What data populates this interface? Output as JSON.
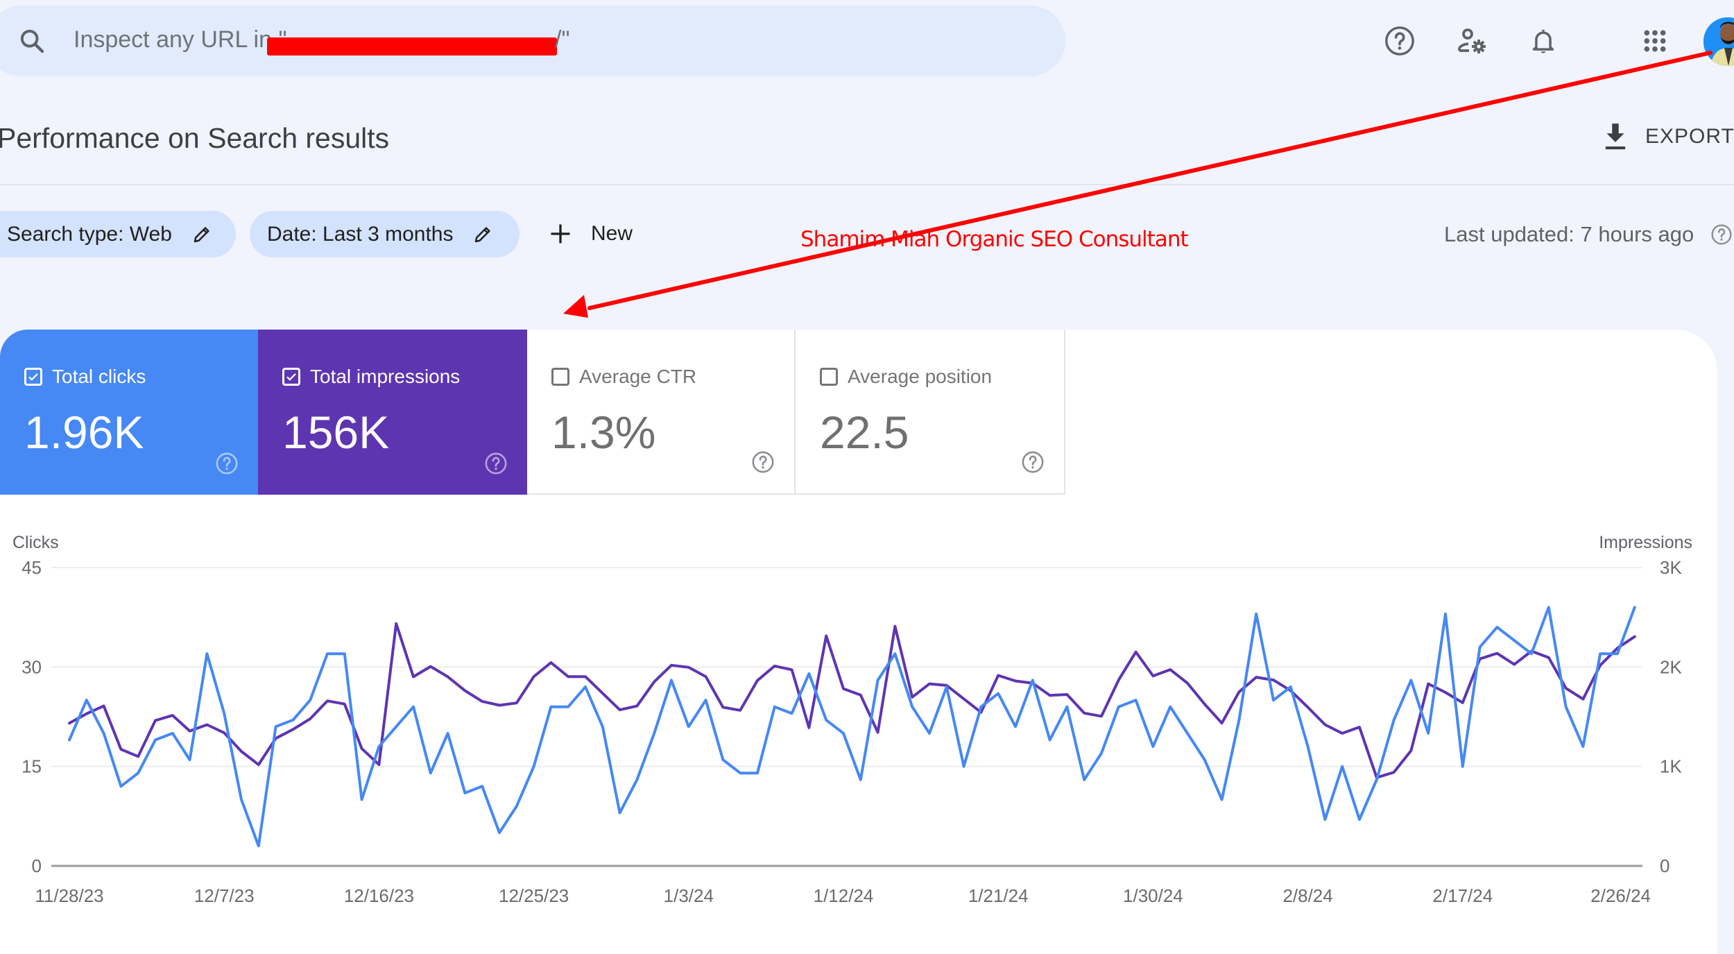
{
  "search": {
    "placeholder_prefix": "Inspect any URL in \"",
    "placeholder_suffix": "/\"",
    "redacted": true
  },
  "top_icons": [
    "help-icon",
    "admin-settings-icon",
    "notifications-bell-icon",
    "apps-grid-icon",
    "account-avatar"
  ],
  "header": {
    "title": "Performance on Search results",
    "export_label": "EXPORT"
  },
  "filters": {
    "search_type": "Search type: Web",
    "date": "Date: Last 3 months",
    "new_label": "New"
  },
  "annotation": {
    "text": "Shamim Miah Organic SEO Consultant",
    "color": "#FF0000"
  },
  "status": {
    "last_updated": "Last updated: 7 hours ago"
  },
  "metrics": [
    {
      "label": "Total clicks",
      "value": "1.96K",
      "checked": true,
      "color": "#4688F4"
    },
    {
      "label": "Total impressions",
      "value": "156K",
      "checked": true,
      "color": "#5E35B1"
    },
    {
      "label": "Average CTR",
      "value": "1.3%",
      "checked": false
    },
    {
      "label": "Average position",
      "value": "22.5",
      "checked": false
    }
  ],
  "chart_data": {
    "type": "line",
    "title": "",
    "xlabel": "",
    "ylabel": "Clicks",
    "y2label": "Impressions",
    "ylim": [
      0,
      45
    ],
    "y2lim": [
      0,
      3000
    ],
    "yticks": [
      "0",
      "15",
      "30",
      "45"
    ],
    "y2ticks": [
      "0",
      "1K",
      "2K",
      "3K"
    ],
    "grid": true,
    "start_date": "11/28/23",
    "end_date": "2/27/24",
    "xtick_labels": [
      "11/28/23",
      "12/7/23",
      "12/16/23",
      "12/25/23",
      "1/3/24",
      "1/12/24",
      "1/21/24",
      "1/30/24",
      "2/8/24",
      "2/17/24",
      "2/26/24"
    ],
    "xtick_every_days": 9,
    "series": [
      {
        "name": "Clicks",
        "axis": "left",
        "color": "#4688F4",
        "values": [
          19,
          25,
          20,
          12,
          14,
          19,
          20,
          16,
          32,
          23,
          10,
          3,
          21,
          22,
          25,
          32,
          32,
          10,
          18,
          21,
          24,
          14,
          20,
          11,
          12,
          5,
          9,
          15,
          24,
          24,
          27,
          21,
          8,
          13,
          20,
          28,
          21,
          25,
          16,
          14,
          14,
          24,
          23,
          29,
          22,
          20,
          13,
          28,
          32,
          24,
          20,
          27,
          15,
          24,
          26,
          21,
          28,
          19,
          24,
          13,
          17,
          24,
          25,
          18,
          24,
          20,
          16,
          10,
          22,
          38,
          25,
          27,
          18,
          7,
          15,
          7,
          13,
          22,
          28,
          20,
          38,
          15,
          33,
          36,
          34,
          32,
          39,
          24,
          18,
          32,
          32,
          39
        ]
      },
      {
        "name": "Impressions",
        "axis": "right",
        "color": "#5E35B1",
        "values": [
          1436,
          1530,
          1608,
          1172,
          1100,
          1462,
          1513,
          1356,
          1420,
          1338,
          1151,
          1018,
          1282,
          1372,
          1479,
          1659,
          1628,
          1180,
          1018,
          2436,
          1902,
          2005,
          1902,
          1762,
          1654,
          1615,
          1638,
          1903,
          2044,
          1903,
          1903,
          1736,
          1569,
          1608,
          1851,
          2018,
          1997,
          1903,
          1595,
          1564,
          1864,
          2010,
          1972,
          1390,
          2313,
          1782,
          1718,
          1343,
          2410,
          1697,
          1831,
          1815,
          1679,
          1544,
          1915,
          1859,
          1838,
          1715,
          1723,
          1536,
          1505,
          1869,
          2151,
          1910,
          1974,
          1838,
          1626,
          1436,
          1749,
          1897,
          1869,
          1762,
          1595,
          1420,
          1333,
          1395,
          888,
          941,
          1159,
          1831,
          1744,
          1641,
          2082,
          2138,
          2026,
          2159,
          2095,
          1787,
          1677,
          2018,
          2190,
          2305
        ]
      }
    ]
  }
}
